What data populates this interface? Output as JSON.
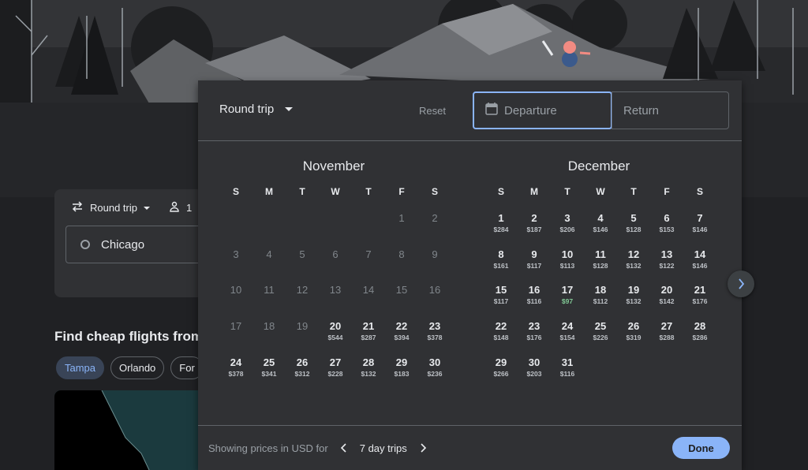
{
  "background": {
    "trip_type": "Round trip",
    "passengers": "1",
    "origin": "Chicago",
    "heading": "Find cheap flights from",
    "chips": [
      {
        "label": "Tampa",
        "active": true
      },
      {
        "label": "Orlando",
        "active": false
      },
      {
        "label": "For",
        "active": false
      }
    ]
  },
  "dialog": {
    "trip_type": "Round trip",
    "reset_label": "Reset",
    "departure_placeholder": "Departure",
    "return_placeholder": "Return",
    "weekdays": [
      "S",
      "M",
      "T",
      "W",
      "T",
      "F",
      "S"
    ],
    "months": [
      {
        "name": "November",
        "offset": 5,
        "days": [
          {
            "d": "1",
            "past": true
          },
          {
            "d": "2",
            "past": true
          },
          {
            "d": "3",
            "past": true
          },
          {
            "d": "4",
            "past": true
          },
          {
            "d": "5",
            "past": true
          },
          {
            "d": "6",
            "past": true
          },
          {
            "d": "7",
            "past": true
          },
          {
            "d": "8",
            "past": true
          },
          {
            "d": "9",
            "past": true
          },
          {
            "d": "10",
            "past": true
          },
          {
            "d": "11",
            "past": true
          },
          {
            "d": "12",
            "past": true
          },
          {
            "d": "13",
            "past": true
          },
          {
            "d": "14",
            "past": true
          },
          {
            "d": "15",
            "past": true
          },
          {
            "d": "16",
            "past": true
          },
          {
            "d": "17",
            "past": true
          },
          {
            "d": "18",
            "past": true
          },
          {
            "d": "19",
            "past": true
          },
          {
            "d": "20",
            "price": "$544"
          },
          {
            "d": "21",
            "price": "$287"
          },
          {
            "d": "22",
            "price": "$394"
          },
          {
            "d": "23",
            "price": "$378"
          },
          {
            "d": "24",
            "price": "$378"
          },
          {
            "d": "25",
            "price": "$341"
          },
          {
            "d": "26",
            "price": "$312"
          },
          {
            "d": "27",
            "price": "$228"
          },
          {
            "d": "28",
            "price": "$132"
          },
          {
            "d": "29",
            "price": "$183"
          },
          {
            "d": "30",
            "price": "$236"
          }
        ]
      },
      {
        "name": "December",
        "offset": 0,
        "days": [
          {
            "d": "1",
            "price": "$284"
          },
          {
            "d": "2",
            "price": "$187"
          },
          {
            "d": "3",
            "price": "$206"
          },
          {
            "d": "4",
            "price": "$146"
          },
          {
            "d": "5",
            "price": "$128"
          },
          {
            "d": "6",
            "price": "$153"
          },
          {
            "d": "7",
            "price": "$146"
          },
          {
            "d": "8",
            "price": "$161"
          },
          {
            "d": "9",
            "price": "$117"
          },
          {
            "d": "10",
            "price": "$113"
          },
          {
            "d": "11",
            "price": "$128"
          },
          {
            "d": "12",
            "price": "$132"
          },
          {
            "d": "13",
            "price": "$122"
          },
          {
            "d": "14",
            "price": "$146"
          },
          {
            "d": "15",
            "price": "$117"
          },
          {
            "d": "16",
            "price": "$116"
          },
          {
            "d": "17",
            "price": "$97",
            "low": true
          },
          {
            "d": "18",
            "price": "$112"
          },
          {
            "d": "19",
            "price": "$132"
          },
          {
            "d": "20",
            "price": "$142"
          },
          {
            "d": "21",
            "price": "$176"
          },
          {
            "d": "22",
            "price": "$148"
          },
          {
            "d": "23",
            "price": "$176"
          },
          {
            "d": "24",
            "price": "$154"
          },
          {
            "d": "25",
            "price": "$226"
          },
          {
            "d": "26",
            "price": "$319"
          },
          {
            "d": "27",
            "price": "$288"
          },
          {
            "d": "28",
            "price": "$286"
          },
          {
            "d": "29",
            "price": "$266"
          },
          {
            "d": "30",
            "price": "$203"
          },
          {
            "d": "31",
            "price": "$116"
          }
        ]
      }
    ],
    "footer": {
      "showing_label": "Showing prices in USD for",
      "trip_length": "7 day trips",
      "done_label": "Done"
    }
  },
  "colors": {
    "accent": "#8ab4f8",
    "low_price": "#81c995",
    "surface": "#303134",
    "page_bg": "#202124"
  }
}
